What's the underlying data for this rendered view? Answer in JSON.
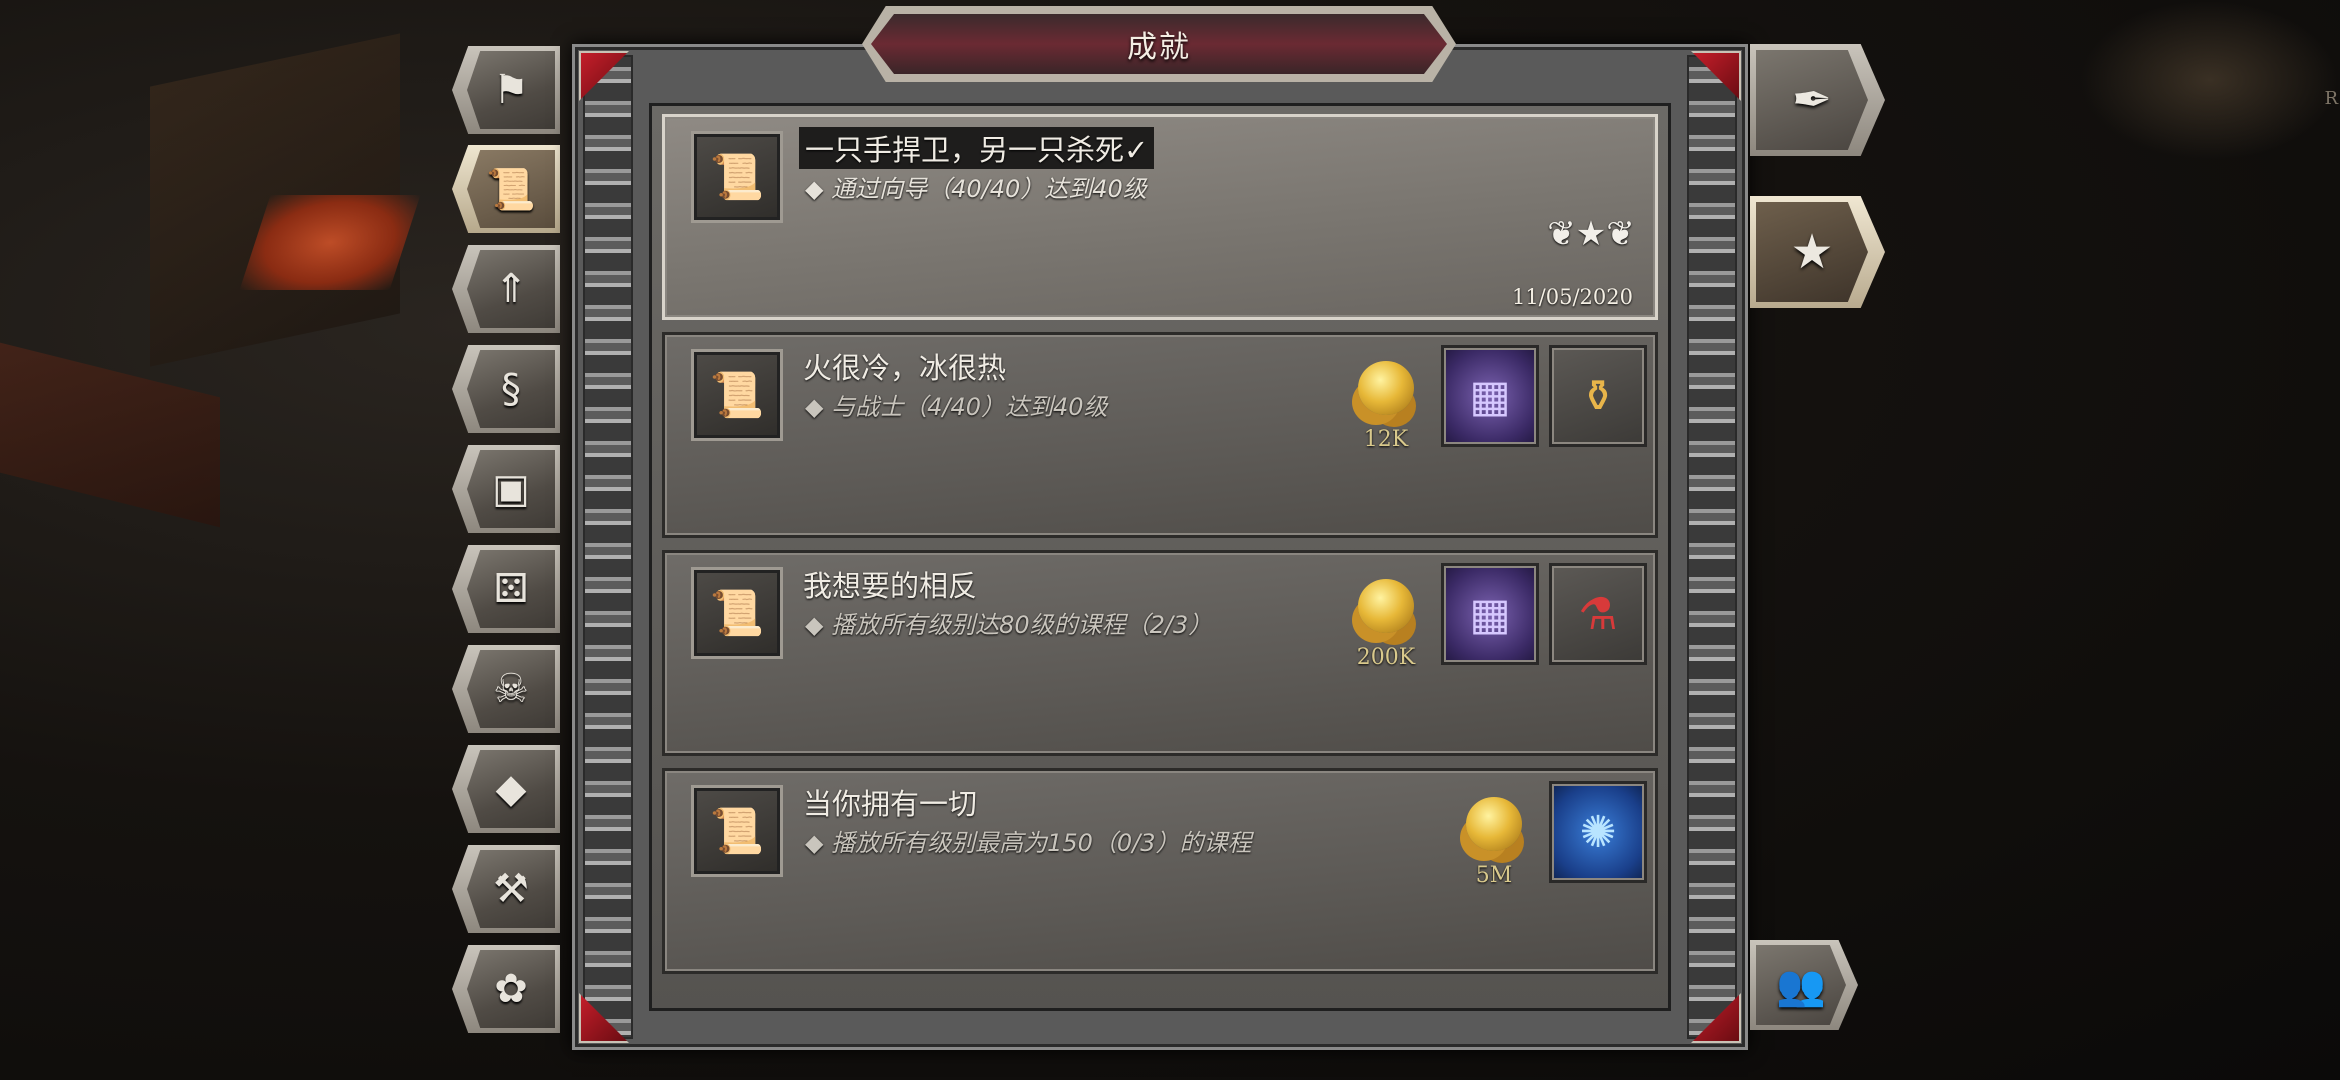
{
  "header": {
    "title": "成就"
  },
  "left_tabs": [
    {
      "name": "quests",
      "icon": "banner-icon",
      "glyph": "⚑"
    },
    {
      "name": "guides",
      "icon": "scroll-icon",
      "glyph": "📜",
      "active": true
    },
    {
      "name": "ascension",
      "icon": "winged-arrow-icon",
      "glyph": "⇑"
    },
    {
      "name": "bosses",
      "icon": "serpent-icon",
      "glyph": "§"
    },
    {
      "name": "treasure",
      "icon": "chest-icon",
      "glyph": "▣"
    },
    {
      "name": "gambling",
      "icon": "dice-icon",
      "glyph": "⚄"
    },
    {
      "name": "demons",
      "icon": "demon-skull-icon",
      "glyph": "☠"
    },
    {
      "name": "gems",
      "icon": "diamond-icon",
      "glyph": "◆"
    },
    {
      "name": "crafting",
      "icon": "hammer-icon",
      "glyph": "⚒"
    },
    {
      "name": "pets",
      "icon": "paw-icon",
      "glyph": "✿"
    }
  ],
  "right_tabs": [
    {
      "name": "feather",
      "icon": "feather-icon",
      "glyph": "✒"
    },
    {
      "name": "rank",
      "icon": "laurel-star-icon",
      "glyph": "★",
      "active": true
    },
    {
      "name": "social",
      "icon": "people-icon",
      "glyph": "👥"
    }
  ],
  "achievements": [
    {
      "title": "一只手捍卫，另一只杀死✓",
      "desc": "◆ 通过向导（40/40）达到40级",
      "date": "11/05/2020",
      "completed": true,
      "icon": "scroll-ii-icon",
      "icon_glyph": "📜"
    },
    {
      "title": "火很冷，冰很热",
      "desc": "◆ 与战士（4/40）达到40级",
      "completed": false,
      "icon": "scroll-i-icon",
      "icon_glyph": "📜",
      "gold": "12K",
      "items": [
        {
          "icon": "purple-cube-icon",
          "glyph": "▦",
          "style": "slot-cube"
        },
        {
          "icon": "flask-icon",
          "glyph": "⚱",
          "style": "slot-flask"
        }
      ]
    },
    {
      "title": "我想要的相反",
      "desc": "◆ 播放所有级别达80级的课程（2/3）",
      "completed": false,
      "icon": "scroll-iv-icon",
      "icon_glyph": "📜",
      "gold": "200K",
      "items": [
        {
          "icon": "purple-cube-icon",
          "glyph": "▦",
          "style": "slot-cube"
        },
        {
          "icon": "red-potion-icon",
          "glyph": "⚗",
          "style": "slot-potion"
        }
      ]
    },
    {
      "title": "当你拥有一切",
      "desc": "◆ 播放所有级别最高为150（0/3）的课程",
      "completed": false,
      "icon": "scroll-v-icon",
      "icon_glyph": "📜",
      "gold": "5M",
      "items": [
        {
          "icon": "blue-rune-icon",
          "glyph": "✺",
          "style": "slot-rune"
        }
      ]
    }
  ],
  "colors": {
    "accent_red": "#c41e2a",
    "gold_text": "#d9c98c",
    "frame": "#8a8a8a"
  },
  "background": {
    "corner_letter": "R"
  }
}
